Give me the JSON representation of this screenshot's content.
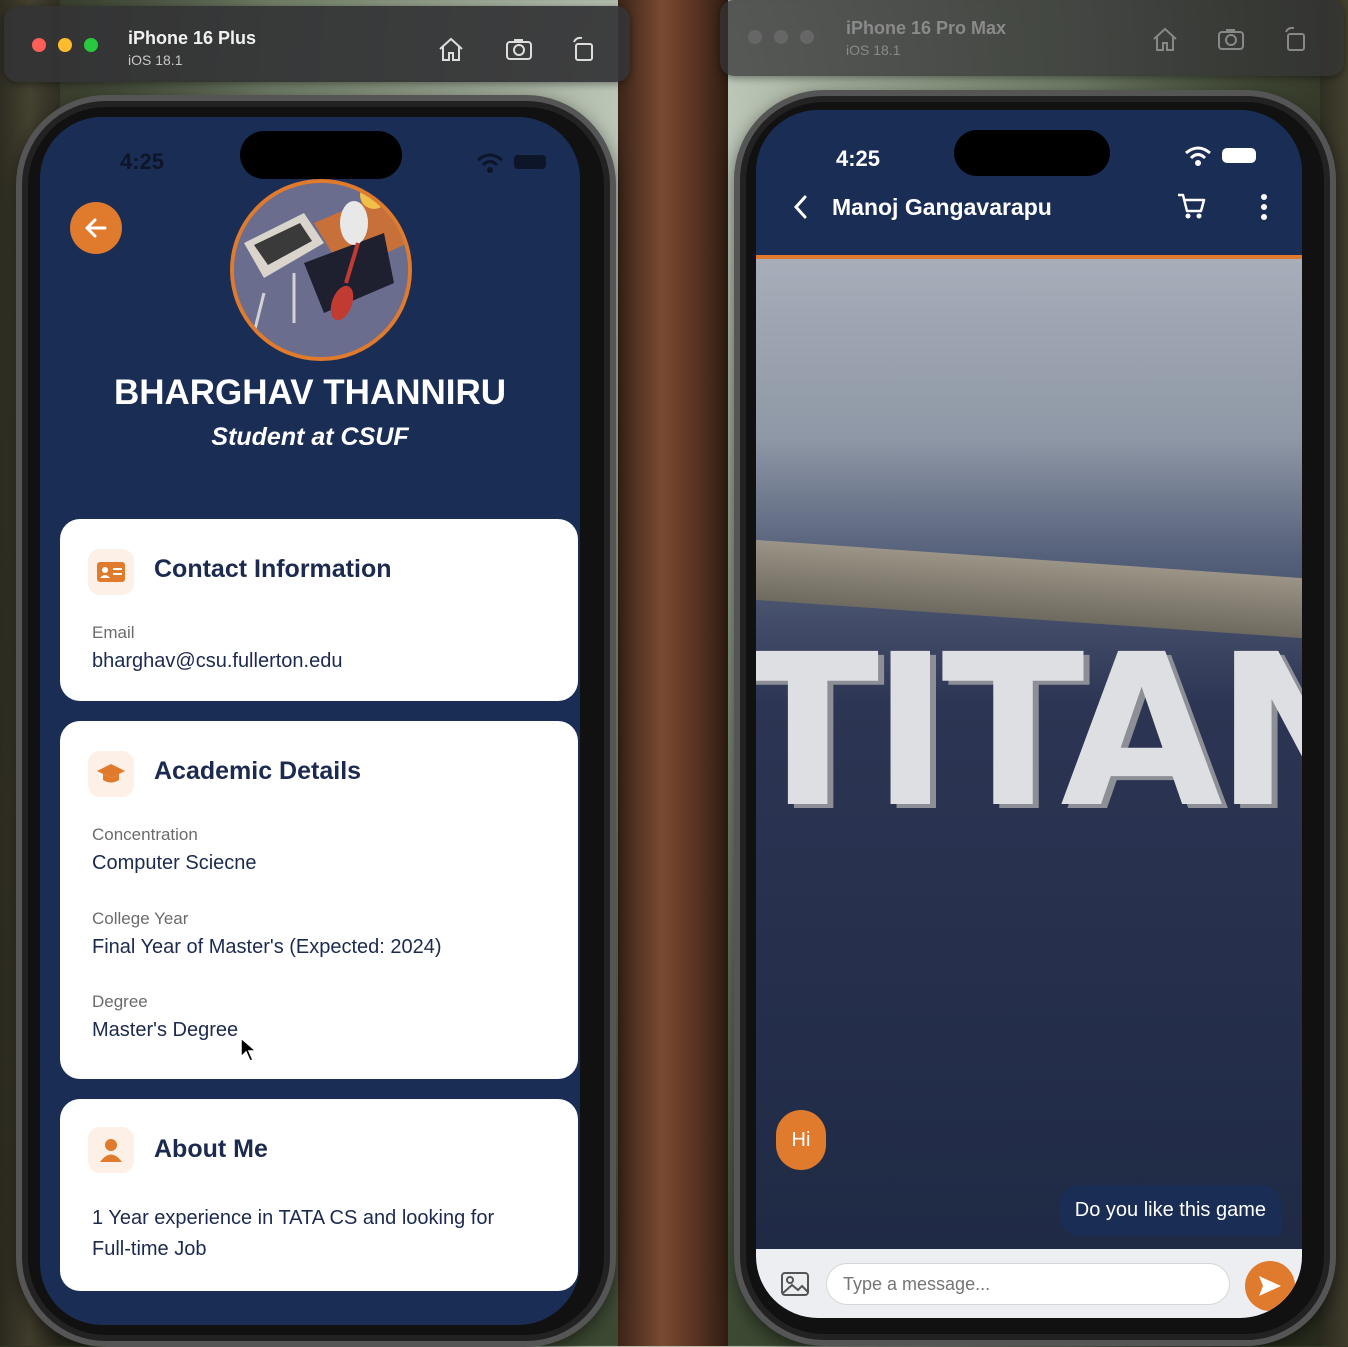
{
  "left_sim": {
    "device": "iPhone 16 Plus",
    "os": "iOS 18.1"
  },
  "right_sim": {
    "device": "iPhone 16 Pro Max",
    "os": "iOS 18.1"
  },
  "profile_screen": {
    "status_time": "4:25",
    "name": "BHARGHAV THANNIRU",
    "subtitle": "Student at CSUF",
    "contact": {
      "title": "Contact Information",
      "email_label": "Email",
      "email_value": "bharghav@csu.fullerton.edu"
    },
    "academic": {
      "title": "Academic Details",
      "concentration_label": "Concentration",
      "concentration_value": "Computer Sciecne",
      "year_label": "College Year",
      "year_value": "Final Year of Master's (Expected: 2024)",
      "degree_label": "Degree",
      "degree_value": "Master's Degree"
    },
    "about": {
      "title": "About Me",
      "text_line1": "1 Year experience in TATA CS and looking for",
      "text_line2": "Full-time Job"
    }
  },
  "chat_screen": {
    "status_time": "4:25",
    "contact_name": "Manoj Gangavarapu",
    "background_sign": "TITANS",
    "messages": [
      {
        "from": "other",
        "text": "Hi"
      },
      {
        "from": "me",
        "text": "Do you like this game"
      }
    ],
    "input_placeholder": "Type a message..."
  },
  "colors": {
    "navy": "#1a2d55",
    "accent_orange": "#e07a2c",
    "card_bg": "#ffffff"
  },
  "icons": [
    "home-icon",
    "screenshot-icon",
    "rotate-icon",
    "back-arrow-icon",
    "contact-card-icon",
    "graduation-cap-icon",
    "person-icon",
    "chevron-left-icon",
    "cart-icon",
    "more-vertical-icon",
    "image-icon",
    "send-icon",
    "wifi-icon",
    "battery-icon"
  ]
}
